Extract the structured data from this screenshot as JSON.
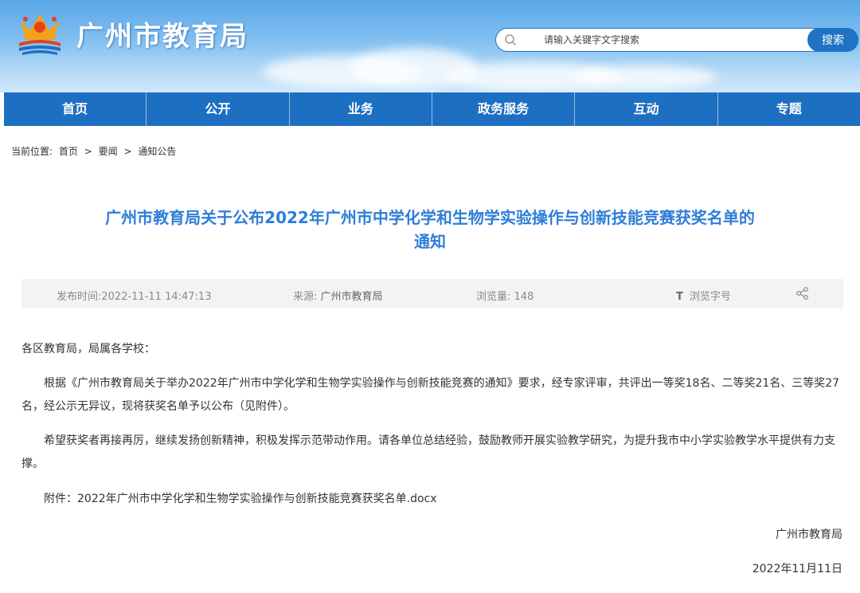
{
  "header": {
    "site_title": "广州市教育局",
    "search_placeholder": "请输入关键字文字搜索",
    "search_button": "搜索"
  },
  "nav": [
    "首页",
    "公开",
    "业务",
    "政务服务",
    "互动",
    "专题"
  ],
  "breadcrumb": {
    "label": "当前位置:",
    "items": [
      "首页",
      "要闻",
      "通知公告"
    ],
    "separator": ">"
  },
  "article": {
    "title_line1": "广州市教育局关于公布2022年广州市中学化学和生物学实验操作与创新技能竞赛获奖名单的",
    "title_line2": "通知",
    "meta": {
      "publish_label": "发布时间:",
      "publish_time": "2022-11-11 14:47:13",
      "source_label": "来源:",
      "source": "广州市教育局",
      "views_label": "浏览量:",
      "views": "148",
      "font_icon": "T",
      "font_label": "浏览字号"
    },
    "salutation": "各区教育局，局属各学校：",
    "para1": "根据《广州市教育局关于举办2022年广州市中学化学和生物学实验操作与创新技能竞赛的通知》要求，经专家评审，共评出一等奖18名、二等奖21名、三等奖27名，经公示无异议，现将获奖名单予以公布（见附件）。",
    "para2": "希望获奖者再接再厉，继续发扬创新精神，积极发挥示范带动作用。请各单位总结经验，鼓励教师开展实验教学研究，为提升我市中小学实验教学水平提供有力支撑。",
    "attachment_label": "附件：",
    "attachment_link": "2022年广州市中学化学和生物学实验操作与创新技能竞赛获奖名单.docx",
    "signature": "广州市教育局",
    "date": "2022年11月11日"
  },
  "colors": {
    "nav_bg": "#1d6fc2",
    "title": "#2f7ed8",
    "search_button": "#1f73c5"
  }
}
